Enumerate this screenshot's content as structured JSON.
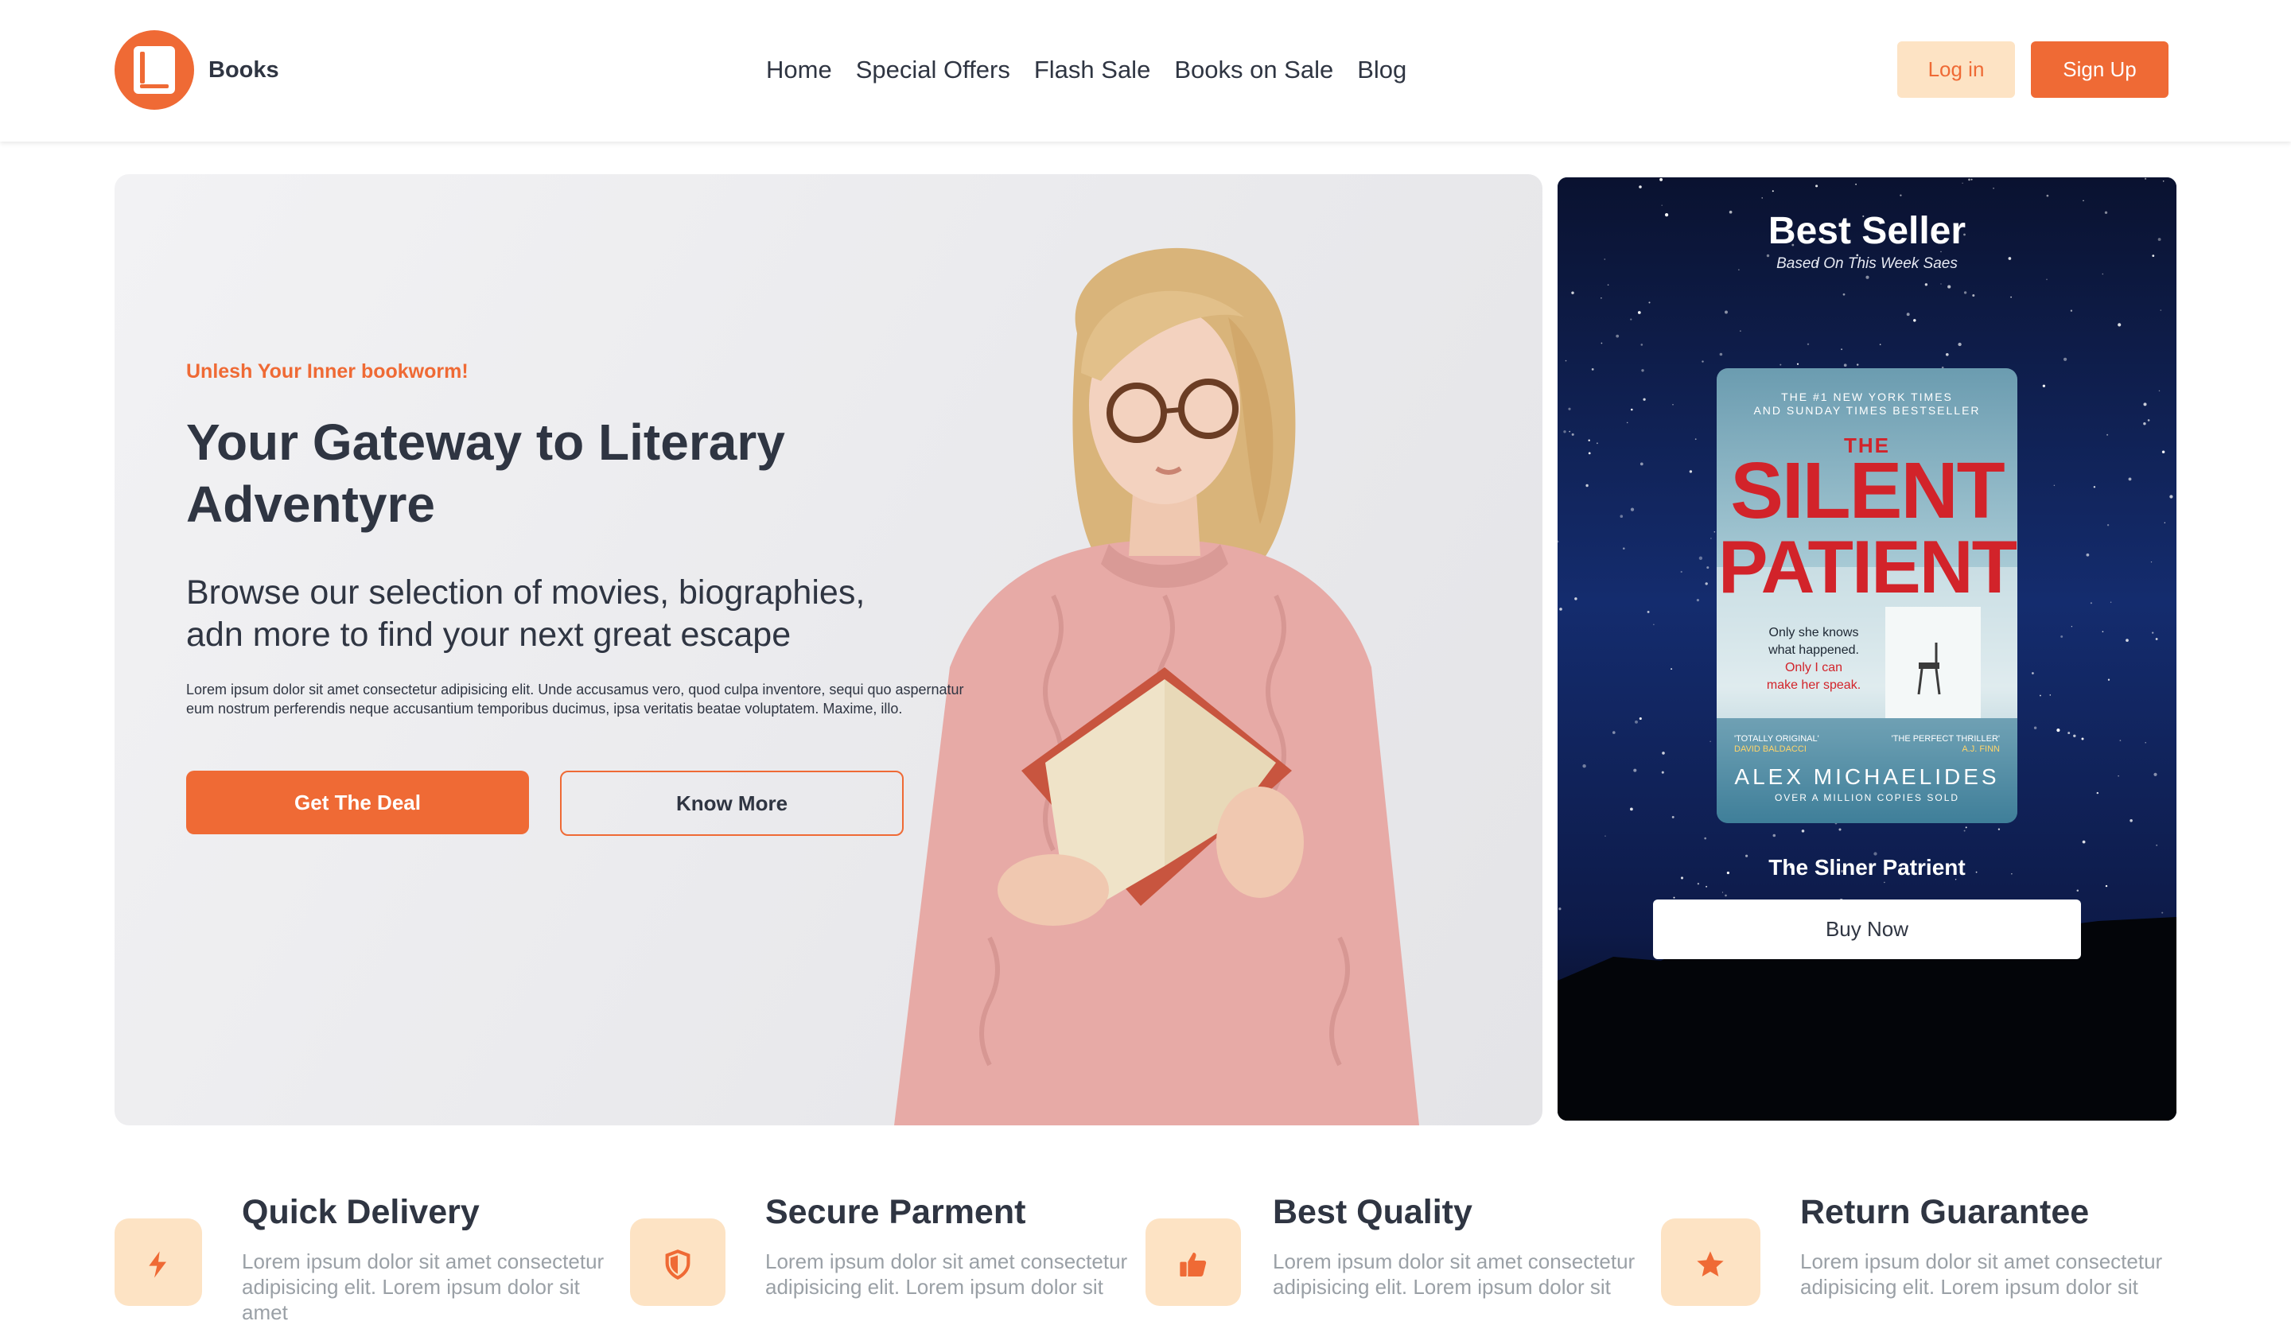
{
  "brand": {
    "name": "Books"
  },
  "nav": {
    "items": [
      {
        "label": "Home"
      },
      {
        "label": "Special Offers"
      },
      {
        "label": "Flash Sale"
      },
      {
        "label": "Books on Sale"
      },
      {
        "label": "Blog"
      }
    ]
  },
  "auth": {
    "login_label": "Log in",
    "signup_label": "Sign Up"
  },
  "hero": {
    "eyebrow": "Unlesh Your Inner bookworm!",
    "title": "Your Gateway to Literary Adventyre",
    "subtitle": "Browse our selection of movies, biographies, adn more to find your next great escape",
    "body": "Lorem ipsum dolor sit amet consectetur adipisicing elit. Unde accusamus vero, quod culpa inventore, sequi quo aspernatur eum nostrum perferendis neque accusantium temporibus ducimus, ipsa veritatis beatae voluptatem. Maxime, illo.",
    "cta_primary": "Get The Deal",
    "cta_secondary": "Know More"
  },
  "best_seller": {
    "title": "Best Seller",
    "caption": "Based On This Week Saes",
    "book_name": "The Sliner Patrient",
    "buy_label": "Buy Now",
    "cover": {
      "tagline_1": "THE #1 NEW YORK TIMES",
      "tagline_2": "AND SUNDAY TIMES BESTSELLER",
      "the": "THE",
      "title_1": "SILENT",
      "title_2": "PATIENT",
      "blurb_1": "Only she knows",
      "blurb_2": "what happened.",
      "blurb_3": "Only I can",
      "blurb_4": "make her speak.",
      "quote_left": "'TOTALLY ORIGINAL'",
      "quote_left_by": "DAVID BALDACCI",
      "quote_right": "'THE PERFECT THRILLER'",
      "quote_right_by": "A.J. FINN",
      "author": "ALEX MICHAELIDES",
      "sold": "OVER A MILLION COPIES SOLD"
    }
  },
  "features": [
    {
      "title": "Quick Delivery",
      "desc": "Lorem ipsum dolor sit amet consectetur adipisicing elit. Lorem ipsum dolor sit amet",
      "icon": "bolt-icon"
    },
    {
      "title": "Secure Parment",
      "desc": "Lorem ipsum dolor sit amet consectetur adipisicing elit. Lorem ipsum dolor sit",
      "icon": "shield-icon"
    },
    {
      "title": "Best Quality",
      "desc": "Lorem ipsum dolor sit amet consectetur adipisicing elit. Lorem ipsum dolor sit",
      "icon": "thumbs-up-icon"
    },
    {
      "title": "Return Guarantee",
      "desc": "Lorem ipsum dolor sit amet consectetur adipisicing elit. Lorem ipsum dolor sit",
      "icon": "star-icon"
    }
  ],
  "colors": {
    "accent": "#ef6a35",
    "accent_soft": "#fde3c4",
    "text": "#2f3542",
    "muted": "#9aa0a6",
    "night": "#0b1433"
  }
}
